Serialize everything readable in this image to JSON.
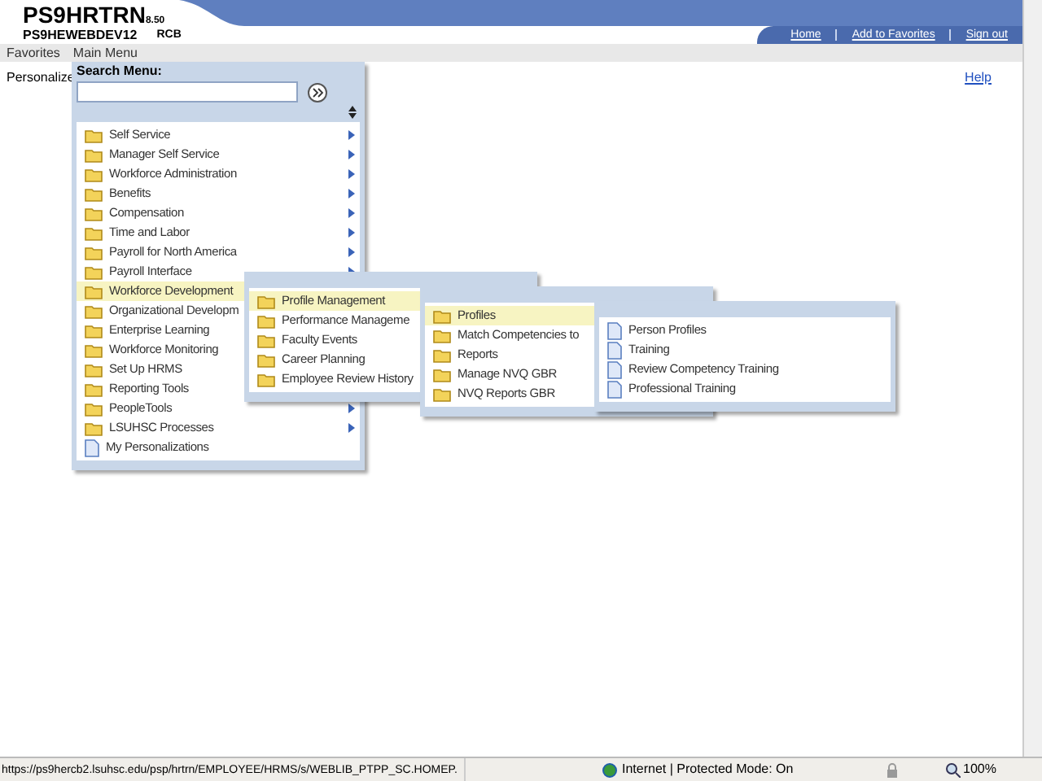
{
  "header": {
    "title": "PS9HRTRN",
    "version": "8.50",
    "server": "PS9HEWEBDEV12",
    "user": "RCB",
    "links": [
      "Home",
      "Add to Favorites",
      "Sign out"
    ]
  },
  "nav": [
    "Favorites",
    "Main Menu"
  ],
  "page": {
    "personalize": "Personalize",
    "help": "Help"
  },
  "menus": [
    {
      "search_label": "Search Menu:",
      "items": [
        {
          "label": "Self Service",
          "kind": "folder",
          "arrow": true,
          "selected": false
        },
        {
          "label": "Manager Self Service",
          "kind": "folder",
          "arrow": true,
          "selected": false
        },
        {
          "label": "Workforce Administration",
          "kind": "folder",
          "arrow": true,
          "selected": false
        },
        {
          "label": "Benefits",
          "kind": "folder",
          "arrow": true,
          "selected": false
        },
        {
          "label": "Compensation",
          "kind": "folder",
          "arrow": true,
          "selected": false
        },
        {
          "label": "Time and Labor",
          "kind": "folder",
          "arrow": true,
          "selected": false
        },
        {
          "label": "Payroll for North America",
          "kind": "folder",
          "arrow": true,
          "selected": false
        },
        {
          "label": "Payroll Interface",
          "kind": "folder",
          "arrow": true,
          "selected": false
        },
        {
          "label": "Workforce Development",
          "kind": "folder",
          "arrow": false,
          "selected": true
        },
        {
          "label": "Organizational Developm",
          "kind": "folder",
          "arrow": false,
          "selected": false
        },
        {
          "label": "Enterprise Learning",
          "kind": "folder",
          "arrow": false,
          "selected": false
        },
        {
          "label": "Workforce Monitoring",
          "kind": "folder",
          "arrow": false,
          "selected": false
        },
        {
          "label": "Set Up HRMS",
          "kind": "folder",
          "arrow": false,
          "selected": false
        },
        {
          "label": "Reporting Tools",
          "kind": "folder",
          "arrow": false,
          "selected": false
        },
        {
          "label": "PeopleTools",
          "kind": "folder",
          "arrow": true,
          "selected": false
        },
        {
          "label": "LSUHSC Processes",
          "kind": "folder",
          "arrow": true,
          "selected": false
        },
        {
          "label": "My Personalizations",
          "kind": "page",
          "arrow": false,
          "selected": false
        }
      ]
    },
    {
      "items": [
        {
          "label": "Profile Management",
          "kind": "folder",
          "arrow": false,
          "selected": true
        },
        {
          "label": "Performance Manageme",
          "kind": "folder",
          "arrow": false,
          "selected": false
        },
        {
          "label": "Faculty Events",
          "kind": "folder",
          "arrow": false,
          "selected": false
        },
        {
          "label": "Career Planning",
          "kind": "folder",
          "arrow": false,
          "selected": false
        },
        {
          "label": "Employee Review History",
          "kind": "folder",
          "arrow": false,
          "selected": false
        }
      ]
    },
    {
      "items": [
        {
          "label": "Profiles",
          "kind": "folder",
          "arrow": false,
          "selected": true
        },
        {
          "label": "Match Competencies to",
          "kind": "folder",
          "arrow": false,
          "selected": false
        },
        {
          "label": "Reports",
          "kind": "folder",
          "arrow": false,
          "selected": false
        },
        {
          "label": "Manage NVQ GBR",
          "kind": "folder",
          "arrow": false,
          "selected": false
        },
        {
          "label": "NVQ Reports GBR",
          "kind": "folder",
          "arrow": false,
          "selected": false
        }
      ]
    },
    {
      "items": [
        {
          "label": "Person Profiles",
          "kind": "page",
          "arrow": false,
          "selected": false
        },
        {
          "label": "Training",
          "kind": "page",
          "arrow": false,
          "selected": false
        },
        {
          "label": "Review Competency Training",
          "kind": "page",
          "arrow": false,
          "selected": false
        },
        {
          "label": "Professional Training",
          "kind": "page",
          "arrow": false,
          "selected": false
        }
      ]
    }
  ],
  "status_bar": {
    "url": "https://ps9hercb2.lsuhsc.edu/psp/hrtrn/EMPLOYEE/HRMS/s/WEBLIB_PTPP_SC.HOMEP.",
    "zone": "Internet | Protected Mode: On",
    "zoom": "100%"
  }
}
